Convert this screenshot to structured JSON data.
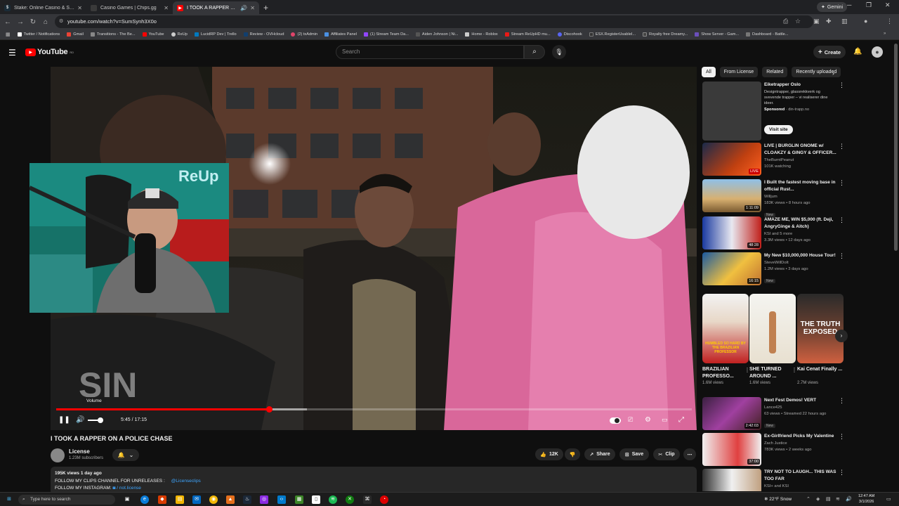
{
  "browser": {
    "tabs": [
      {
        "label": "Stake: Online Casino & Sports B",
        "active": false,
        "icon": "stake-icon",
        "color": "#1a2c38"
      },
      {
        "label": "Casino Games | Chips.gg",
        "active": false,
        "icon": "chips-icon",
        "color": "#3a3a3a"
      },
      {
        "label": "I TOOK A RAPPER ON A PO",
        "active": true,
        "icon": "youtube-icon",
        "color": "#ff0000"
      }
    ],
    "gemini_label": "Gemini",
    "url": "youtube.com/watch?v=SumSynh3X0o",
    "bookmarks": [
      {
        "label": "Twitter / Notifications",
        "color": "#ffffff"
      },
      {
        "label": "Gmail",
        "color": "#ea4335"
      },
      {
        "label": "Transitions - The Be...",
        "color": "#888888"
      },
      {
        "label": "YouTube",
        "color": "#ff0000"
      },
      {
        "label": "ReUp",
        "color": "#cccccc"
      },
      {
        "label": "LucidRP Dev | Trello",
        "color": "#0079bf"
      },
      {
        "label": "Review - OVHcloud",
        "color": "#123f6d"
      },
      {
        "label": "(2) txAdmin",
        "color": "#e0446a"
      },
      {
        "label": "Affiliates Panel",
        "color": "#4a90e2"
      },
      {
        "label": "(1) Stream Team Da...",
        "color": "#9146ff"
      },
      {
        "label": "Aiden Johnson | Ni...",
        "color": "#555555"
      },
      {
        "label": "Home - Roblox",
        "color": "#cccccc"
      },
      {
        "label": "Stream ReUpHD mu...",
        "color": "#e91916"
      },
      {
        "label": "Discohook",
        "color": "#5865f2"
      },
      {
        "label": "ESX.RegisterUsableI...",
        "color": "#333333"
      },
      {
        "label": "Royalty free Dreamy...",
        "color": "#444444"
      },
      {
        "label": "Show Server - Gam...",
        "color": "#6b4fbb"
      },
      {
        "label": "Dashboard - Battle...",
        "color": "#777777"
      }
    ]
  },
  "youtube": {
    "logo_text": "YouTube",
    "logo_suffix": "RO",
    "search_placeholder": "Search",
    "create_label": "Create"
  },
  "player": {
    "volume_tooltip": "Volume",
    "time": "5:45 / 17:15",
    "played_fraction": 0.335,
    "buffered_fraction": 0.395,
    "volume_fraction": 0.75
  },
  "video": {
    "title": "I TOOK A RAPPER ON A POLICE CHASE",
    "channel": "License",
    "subscribers": "1.23M subscribers",
    "likes": "12K",
    "share_label": "Share",
    "save_label": "Save",
    "clip_label": "Clip",
    "views_date": "195K views  1 day ago",
    "desc_line1": "FOLLOW MY CLIPS CHANNEL FOR UNRELEASES :",
    "desc_link1": "@Licenseclips",
    "desc_line2": "FOLLOW MY INSTAGRAM:",
    "desc_link2": "/ not.license"
  },
  "sidebar": {
    "chips": [
      "All",
      "From License",
      "Related",
      "Recently uploaded"
    ],
    "ad": {
      "title": "Eiketrapper Oslo",
      "body": "Designtrapper, glassrekkverk og svevende trapper – vi realiserer dine ideer.",
      "sponsored": "Sponsored",
      "domain": "din-trapp.no",
      "button": "Visit site"
    },
    "recs": [
      {
        "title": "LIVE | BURGLIN GNOME w/ CLOAKZY & GINGY & OFFICER...",
        "channel": "TheBurntPeanut",
        "views": "101K watching",
        "badge": "LIVE",
        "new": ""
      },
      {
        "title": "I Built the fastest moving base in official Rust...",
        "channel": "Willjum",
        "views": "183K views • 8 hours ago",
        "badge": "1:11:09",
        "new": "New"
      },
      {
        "title": "AMAZE ME, WIN $5,000 (ft. Deji, AngryGinge & Aitch)",
        "channel": "KSI  and 5 more",
        "views": "3.3M views • 12 days ago",
        "badge": "48:28",
        "new": ""
      },
      {
        "title": "My New $10,000,000 House Tour!",
        "channel": "SteveWillDoIt",
        "views": "1.2M views • 3 days ago",
        "badge": "16:15",
        "new": "New"
      }
    ],
    "shorts": [
      {
        "title": "BRAZILIAN PROFESSO...",
        "views": "1.6M views",
        "overlay": "HUMBLED SO HARD BY THE BRAZILIAN PROFESSOR"
      },
      {
        "title": "SHE TURNED AROUND ...",
        "views": "1.6M views",
        "overlay": ""
      },
      {
        "title": "Kai Cenat Finally ...",
        "views": "2.7M views",
        "overlay": "THE TRUTH EXPOSED"
      }
    ],
    "recs2": [
      {
        "title": "Next Fest Demos! VERT",
        "channel": "Lance425",
        "views": "63 views • Streamed 22 hours ago",
        "badge": "2:42:03",
        "new": "New"
      },
      {
        "title": "Ex-Girlfriend Picks My Valentine",
        "channel": "Zach Justice",
        "views": "783K views • 2 weeks ago",
        "badge": "37:00",
        "new": ""
      },
      {
        "title": "TRY NOT TO LAUGH... THIS WAS TOO FAR",
        "channel": "KSI+ and KSI",
        "views": "",
        "badge": "",
        "new": ""
      }
    ]
  },
  "taskbar": {
    "search_placeholder": "Type here to search",
    "weather": "22°F  Snow",
    "time": "12:47 AM",
    "date": "3/1/2026"
  },
  "colors": {
    "accent": "#ff0000",
    "link": "#3ea6ff",
    "bg": "#0f0f0f"
  }
}
